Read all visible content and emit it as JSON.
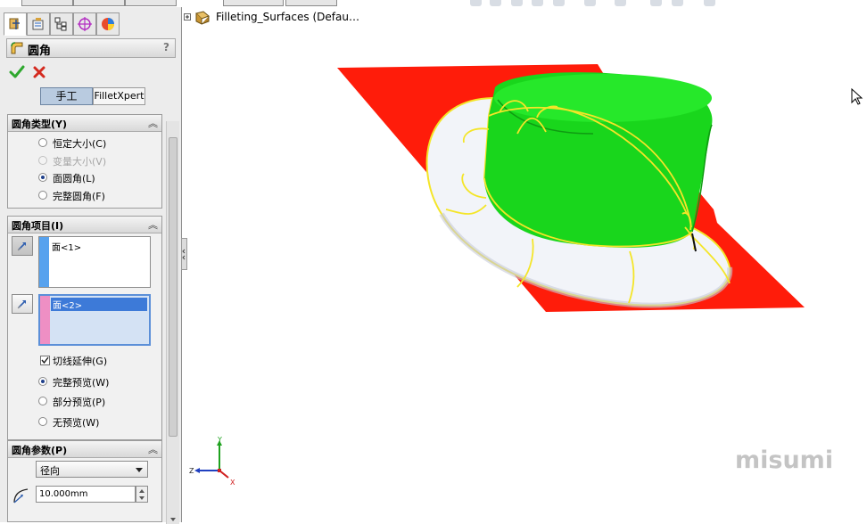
{
  "property_manager": {
    "title": "圆角",
    "help": "?",
    "modes": {
      "manual": "手工",
      "expert": "FilletXpert"
    },
    "fillet_type": {
      "title": "圆角类型(Y)",
      "options": [
        {
          "label": "恒定大小(C)",
          "enabled": true,
          "selected": false
        },
        {
          "label": "变量大小(V)",
          "enabled": false,
          "selected": false
        },
        {
          "label": "面圆角(L)",
          "enabled": true,
          "selected": true
        },
        {
          "label": "完整圆角(F)",
          "enabled": true,
          "selected": false
        }
      ]
    },
    "fillet_items": {
      "title": "圆角项目(I)",
      "face_set_1": "面<1>",
      "face_set_2": "面<2>",
      "face_set_1_color": "#57a2ee",
      "face_set_2_color": "#ee8fc4",
      "tangent_propagation": {
        "label": "切线延伸(G)",
        "checked": true
      },
      "preview": [
        {
          "label": "完整预览(W)",
          "selected": true
        },
        {
          "label": "部分预览(P)",
          "selected": false
        },
        {
          "label": "无预览(W)",
          "selected": false
        }
      ]
    },
    "fillet_params": {
      "title": "圆角参数(P)",
      "method": "径向",
      "radius": "10.000mm"
    }
  },
  "graphics": {
    "tree_node": "Filleting_Surfaces  (Defau…",
    "watermark": "misumi",
    "triad": {
      "x": "X",
      "y": "Y",
      "z": "Z"
    },
    "colors": {
      "surface_red": "#ff1c0a",
      "surface_green": "#19d61c",
      "fillet_edges": "#f4e528"
    }
  }
}
